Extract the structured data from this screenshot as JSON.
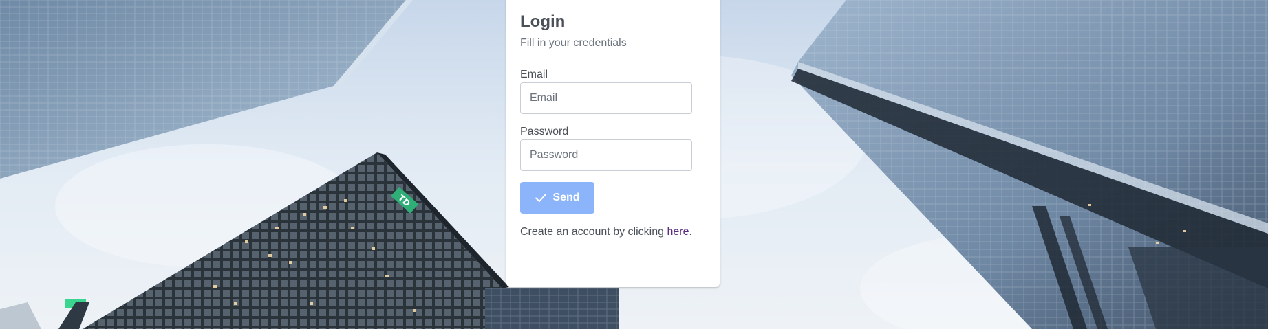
{
  "login": {
    "title": "Login",
    "subtitle": "Fill in your credentials",
    "email": {
      "label": "Email",
      "placeholder": "Email",
      "value": ""
    },
    "password": {
      "label": "Password",
      "placeholder": "Password",
      "value": ""
    },
    "send_label": "Send",
    "footer": {
      "prefix": "Create an account by clicking ",
      "link_text": "here",
      "suffix": "."
    }
  },
  "background": {
    "description_icon": "city-skyscrapers-background",
    "building_sign": "TD"
  },
  "colors": {
    "button": "#8cb4fa",
    "link": "#5a2d82",
    "heading": "#4a5058",
    "sign": "#2fae78"
  }
}
